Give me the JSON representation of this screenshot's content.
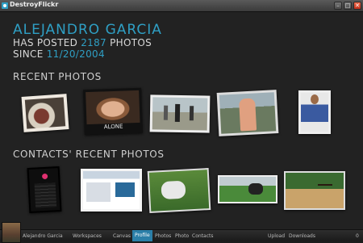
{
  "window": {
    "title": "DestroyFlickr"
  },
  "profile": {
    "name": "ALEJANDRO GARCIA",
    "posted_prefix": "HAS POSTED",
    "photo_count": "2187",
    "photos_word": "PHOTOS",
    "since_prefix": "SINCE",
    "since_date": "11/20/2004"
  },
  "sections": {
    "recent": "RECENT PHOTOS",
    "contacts": "CONTACTS' RECENT PHOTOS"
  },
  "bottom_bar": {
    "user_name": "Alejandro Garcia",
    "nav": [
      "Workspaces",
      "Canvas",
      "Profile",
      "Photos",
      "Photo",
      "Contacts"
    ],
    "active": "Profile",
    "upload": "Upload",
    "downloads": "Downloads",
    "downloads_count": "0"
  },
  "photo_captions": {
    "alone": "ALONE"
  }
}
